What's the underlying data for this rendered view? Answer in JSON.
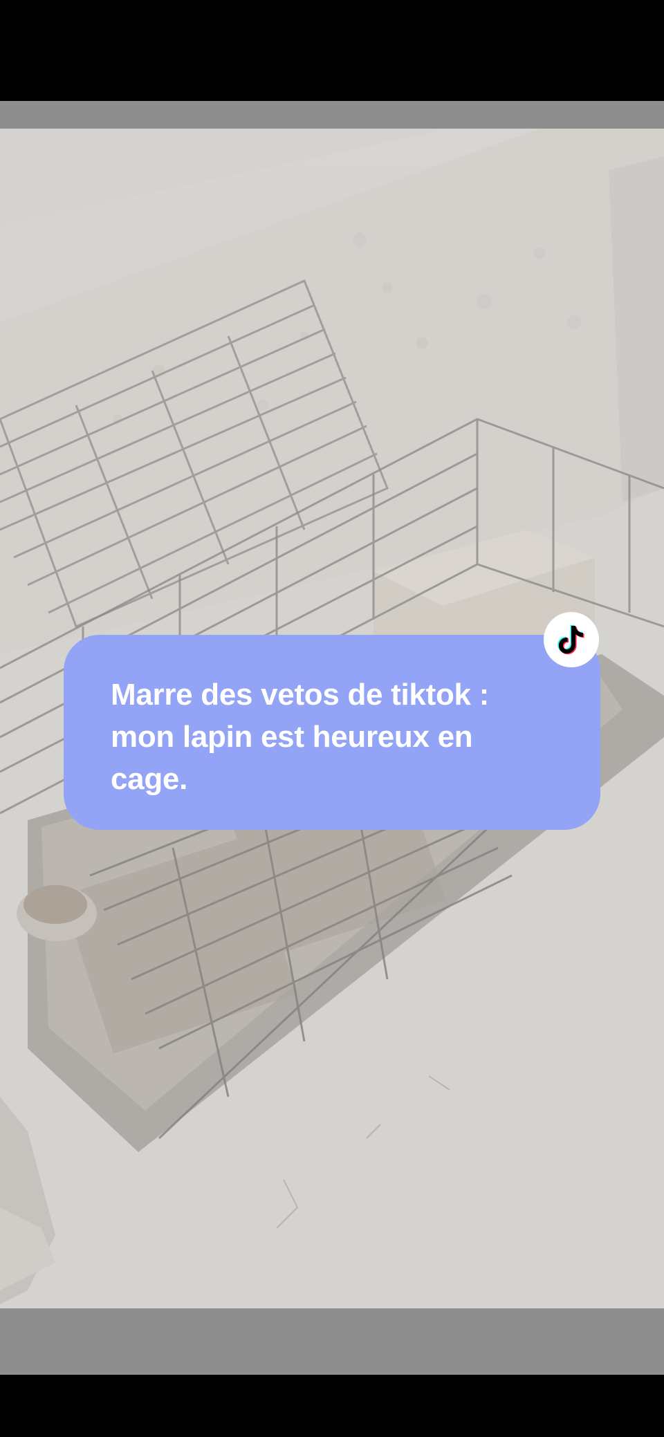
{
  "post": {
    "caption": "Marre des vetos de tiktok :\nmon lapin est heureux en\ncage.",
    "badge_icon": "tiktok-logo-icon"
  },
  "photo": {
    "subject": "rabbit-cage-photo"
  },
  "colors": {
    "caption_background": "#93a3f5",
    "caption_text": "#ffffff",
    "letterbox": "#8e8e8e",
    "status_bars": "#000000"
  }
}
